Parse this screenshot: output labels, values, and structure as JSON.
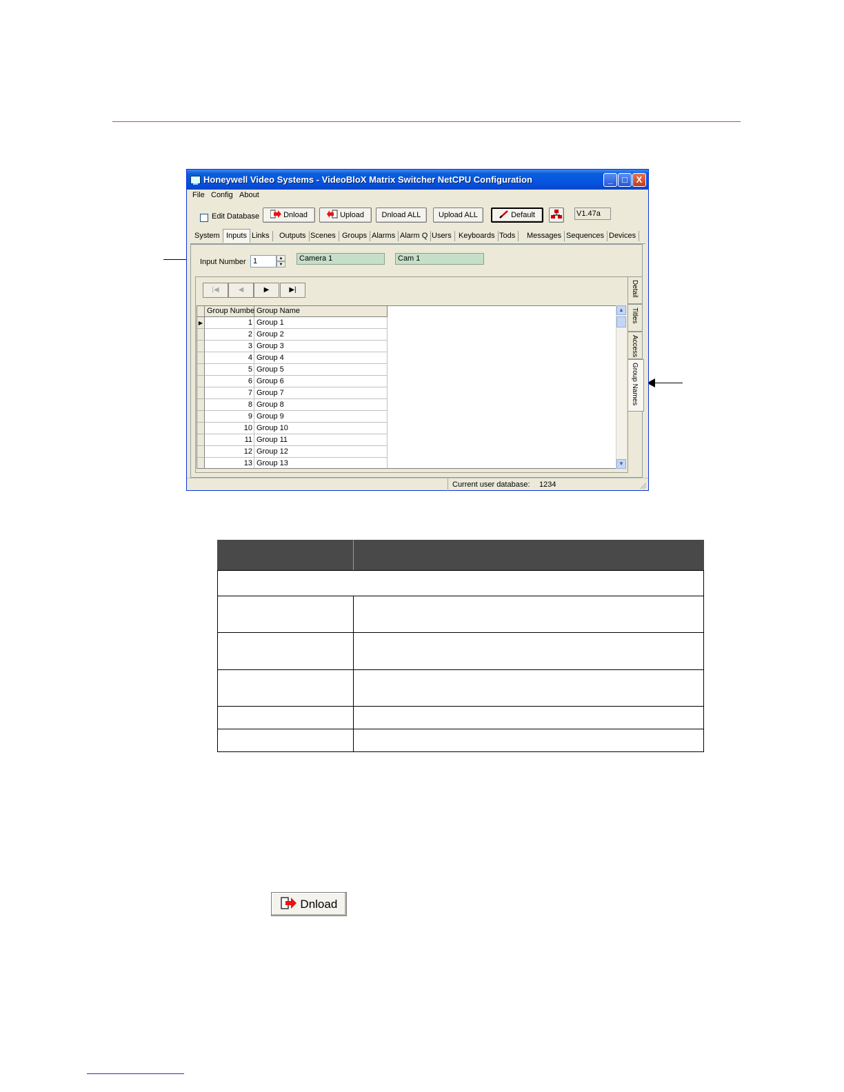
{
  "window": {
    "title": "Honeywell Video Systems - VideoBloX Matrix Switcher NetCPU Configuration",
    "controls": {
      "minimize": "_",
      "maximize": "□",
      "close": "X"
    }
  },
  "menu": [
    "File",
    "Config",
    "About"
  ],
  "toolbar": {
    "edit_database_label": "Edit Database",
    "dnload_label": "Dnload",
    "upload_label": "Upload",
    "dnload_all_label": "Dnload ALL",
    "upload_all_label": "Upload ALL",
    "default_label": "Default",
    "version": "V1.47a"
  },
  "tabs": [
    "System",
    "Inputs",
    "Links",
    "Outputs",
    "Scenes",
    "Groups",
    "Alarms",
    "Alarm Q",
    "Users",
    "Keyboards",
    "Tods",
    "Messages",
    "Sequences",
    "Devices"
  ],
  "active_tab": "Inputs",
  "input": {
    "label": "Input Number",
    "value": "1",
    "camera_name": "Camera 1",
    "short_name": "Cam  1"
  },
  "side_tabs": [
    "Detail",
    "Titles",
    "Access",
    "Group Names"
  ],
  "active_side_tab": "Group Names",
  "grid": {
    "headers": [
      "Group Number",
      "Group Name"
    ],
    "rows": [
      {
        "num": "1",
        "name": "Group 1"
      },
      {
        "num": "2",
        "name": "Group 2"
      },
      {
        "num": "3",
        "name": "Group 3"
      },
      {
        "num": "4",
        "name": "Group 4"
      },
      {
        "num": "5",
        "name": "Group 5"
      },
      {
        "num": "6",
        "name": "Group 6"
      },
      {
        "num": "7",
        "name": "Group 7"
      },
      {
        "num": "8",
        "name": "Group 8"
      },
      {
        "num": "9",
        "name": "Group 9"
      },
      {
        "num": "10",
        "name": "Group 10"
      },
      {
        "num": "11",
        "name": "Group 11"
      },
      {
        "num": "12",
        "name": "Group 12"
      },
      {
        "num": "13",
        "name": "Group 13"
      }
    ]
  },
  "status": {
    "label": "Current user database:",
    "value": "1234"
  },
  "standalone_button": {
    "label": "Dnload"
  },
  "colors": {
    "rule_top": "#d24545",
    "rule_bottom": "#2a2ad0",
    "titlebar": "#0554e3",
    "table_header": "#494949",
    "name_field": "#c5dfc9"
  }
}
